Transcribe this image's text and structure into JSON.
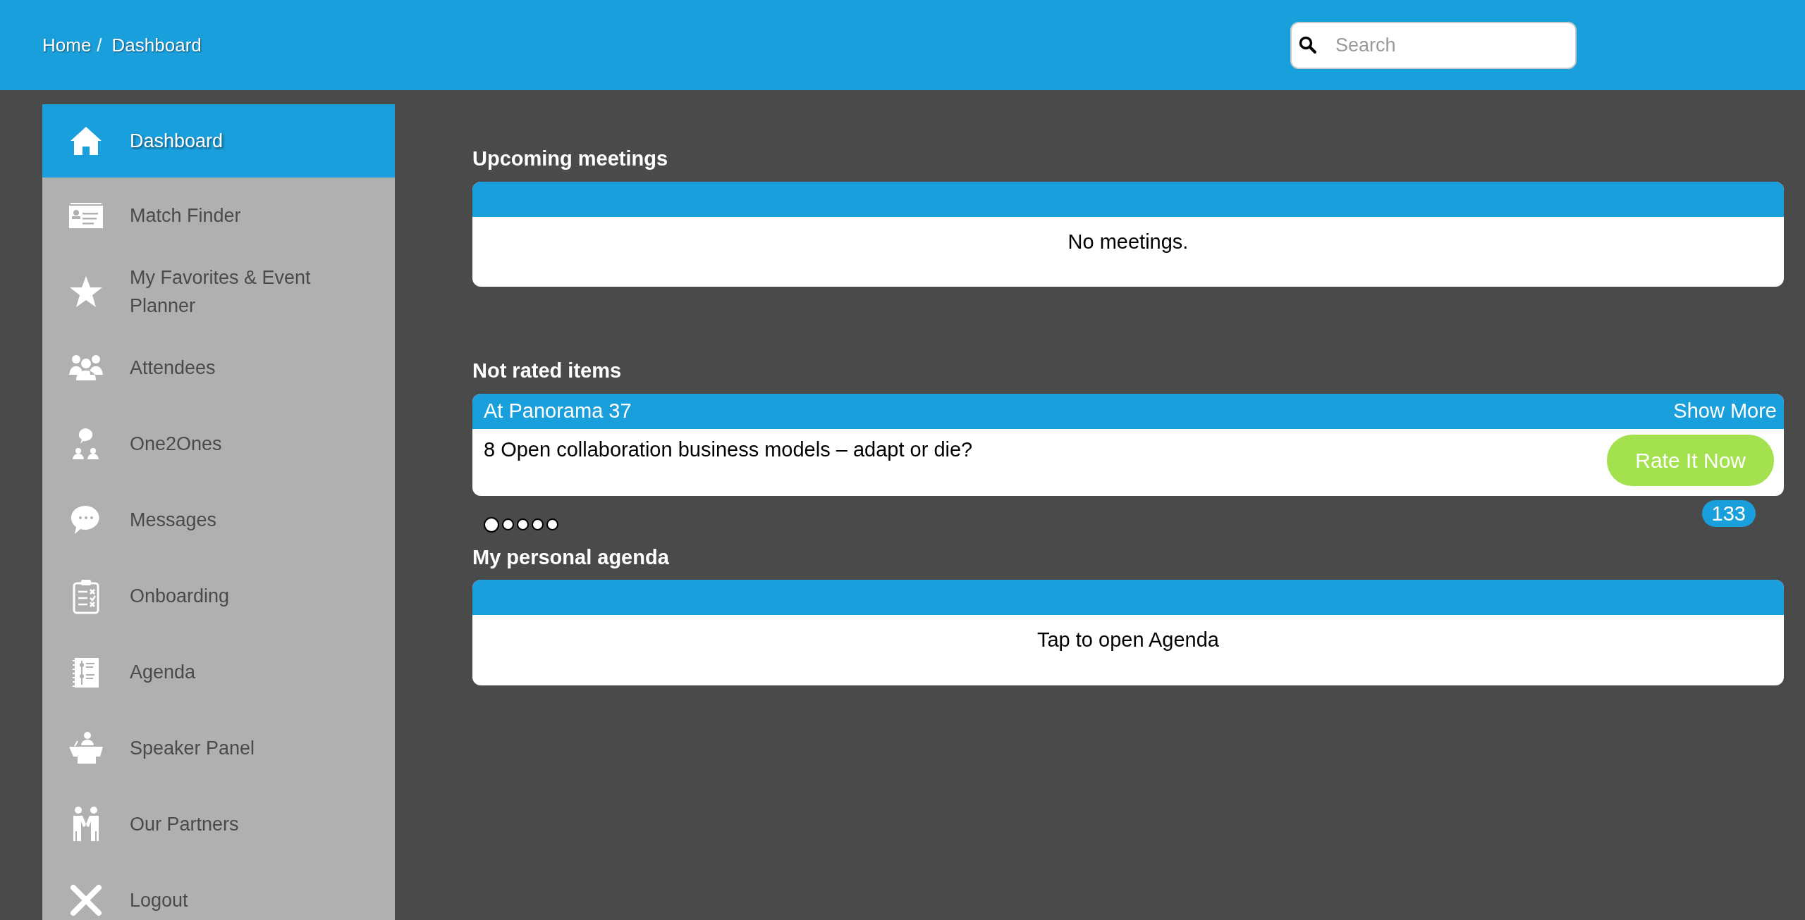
{
  "breadcrumb": {
    "items": [
      "Home",
      "Dashboard"
    ],
    "separator": "/"
  },
  "search": {
    "placeholder": "Search"
  },
  "sidebar": {
    "items": [
      {
        "label": "Dashboard",
        "selected": true
      },
      {
        "label": "Match Finder",
        "selected": false
      },
      {
        "label": "My Favorites & Event Planner",
        "selected": false
      },
      {
        "label": "Attendees",
        "selected": false
      },
      {
        "label": "One2Ones",
        "selected": false
      },
      {
        "label": "Messages",
        "selected": false
      },
      {
        "label": "Onboarding",
        "selected": false
      },
      {
        "label": "Agenda",
        "selected": false
      },
      {
        "label": "Speaker Panel",
        "selected": false
      },
      {
        "label": "Our Partners",
        "selected": false
      },
      {
        "label": "Logout",
        "selected": false
      }
    ]
  },
  "upcoming_meetings": {
    "title": "Upcoming meetings",
    "message": "No meetings."
  },
  "not_rated_items": {
    "title": "Not rated items",
    "location": "At Panorama 37",
    "show_more": "Show More",
    "item": "8 Open collaboration business models – adapt or die?",
    "button": "Rate It Now",
    "count": "133",
    "pager": [
      {
        "selected": true
      },
      {
        "selected": false
      },
      {
        "selected": false
      },
      {
        "selected": false
      },
      {
        "selected": false
      }
    ]
  },
  "personal_agenda": {
    "title": "My personal agenda",
    "message": "Tap to open Agenda"
  }
}
